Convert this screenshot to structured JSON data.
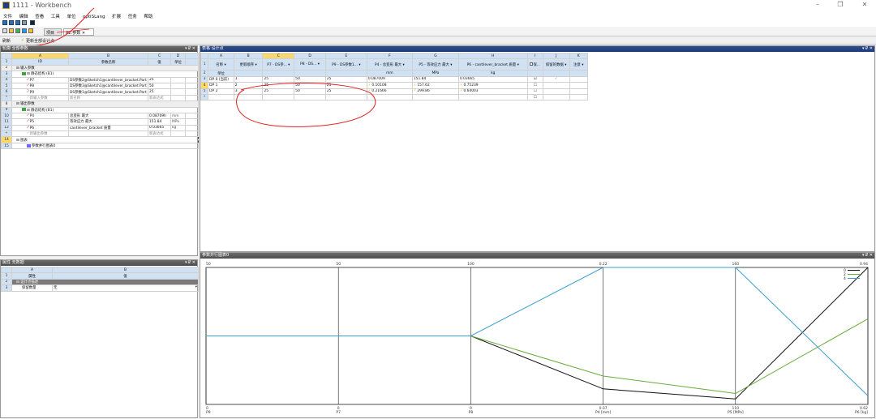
{
  "window": {
    "title": "1111 - Workbench",
    "controls": [
      "–",
      "❐",
      "✕"
    ]
  },
  "menu": [
    "文件",
    "编辑",
    "查看",
    "工具",
    "单位",
    "optiSLang",
    "扩展",
    "任务",
    "帮助"
  ],
  "tabs": {
    "project": "项目",
    "workspace": "A2:参数 ✕"
  },
  "toolbar3": {
    "refresh": "刷新",
    "update_all": "更新全部设计点"
  },
  "outline": {
    "header": "轮廓 全部参数",
    "controls": "▾ ₽ ✕",
    "col_letters": [
      "A",
      "B",
      "C",
      "D"
    ],
    "col_headers": [
      "ID",
      "参数名称",
      "值",
      "单位"
    ],
    "rows": [
      {
        "num": "1",
        "id": "ID",
        "name": "参数名称",
        "value": "值",
        "unit": "单位"
      },
      {
        "num": "2",
        "id": "⊟  输入参数",
        "name": "",
        "value": "",
        "unit": ""
      },
      {
        "num": "3",
        "id": "⊟  静态结构 (B1)",
        "name": "",
        "value": "",
        "unit": ""
      },
      {
        "num": "4",
        "id": "P7",
        "name": "DS参数2@Sketch1@cantilever_bracket.Part",
        "value": "25",
        "unit": ""
      },
      {
        "num": "5",
        "id": "P8",
        "name": "DS参数3@Sketch1@cantilever_bracket.Part",
        "value": "50",
        "unit": ""
      },
      {
        "num": "6",
        "id": "P9",
        "name": "DS参数1@Sketch1@cantilever_bracket.Part",
        "value": "25",
        "unit": ""
      },
      {
        "num": "*",
        "id": "新输入参数",
        "name": "新名称",
        "value": "新表达式",
        "unit": ""
      },
      {
        "num": "8",
        "id": "⊟  输出参数",
        "name": "",
        "value": "",
        "unit": ""
      },
      {
        "num": "9",
        "id": "⊟  静态结构 (B1)",
        "name": "",
        "value": "",
        "unit": ""
      },
      {
        "num": "10",
        "id": "P4",
        "name": "总变形 最大",
        "value": "0.08709h",
        "unit": "mm"
      },
      {
        "num": "11",
        "id": "P5",
        "name": "等效应力 最大",
        "value": "151.84",
        "unit": "MPa"
      },
      {
        "num": "12",
        "id": "P6",
        "name": "cantilever_bracket 质量",
        "value": "0.03665",
        "unit": "kg"
      },
      {
        "num": "*",
        "id": "新输出参数",
        "name": "",
        "value": "新表达式",
        "unit": ""
      },
      {
        "num": "14",
        "id": "⊟  图表",
        "name": "",
        "value": "",
        "unit": ""
      },
      {
        "num": "15",
        "id": "参数并行图表0",
        "name": "",
        "value": "",
        "unit": ""
      }
    ]
  },
  "properties": {
    "header": "属性 无数据",
    "controls": "▾ ₽ ✕",
    "col_letters": [
      "A",
      "B"
    ],
    "col_headers": [
      "属性",
      "值"
    ],
    "rows": [
      {
        "num": "1",
        "prop": "属性",
        "value": "值"
      },
      {
        "num": "2",
        "prop": "⊟  设计点描述",
        "value": ""
      },
      {
        "num": "3",
        "prop": "保留数量",
        "value": "无"
      }
    ]
  },
  "design_points": {
    "header": "表格 设计点",
    "controls": "▾ ₽ ✕",
    "col_letters": [
      "A",
      "B",
      "C",
      "D",
      "E",
      "F",
      "G",
      "H",
      "I",
      "J",
      "K"
    ],
    "col_headers": [
      "名称",
      "更新顺序",
      "P7 - DS参...",
      "P8 - DS...",
      "P9 - DS参数1...",
      "P4 - 总变形 最大",
      "P5 - 等效应力 最大",
      "P6 - cantilever_bracket 质量",
      "保...",
      "保留的数据",
      "注意"
    ],
    "units": [
      "单位",
      "",
      "",
      "",
      "",
      "mm",
      "MPa",
      "kg",
      "",
      "",
      ""
    ],
    "rows": [
      {
        "num": "3",
        "name": "DP 0 (当前)",
        "order": "1",
        "p7": "25",
        "p8": "50",
        "p9": "25",
        "p4": "0.087009",
        "p5": "151.84",
        "p6": "0.03665",
        "keep": "☑",
        "kept": "✓",
        "note": ""
      },
      {
        "num": "4",
        "name": "DP 1",
        "order": "2",
        "p7": "25",
        "p8": "50",
        "p9": "25",
        "p4": "0.10108",
        "p5": "157.62",
        "p6": "0.75239",
        "keep": "☐",
        "kept": "",
        "note": ""
      },
      {
        "num": "5",
        "name": "DP 2",
        "order": "3",
        "p7": "25",
        "p8": "50",
        "p9": "25",
        "p4": "0.21666",
        "p5": "299.86",
        "p6": "0.64003",
        "keep": "☐",
        "kept": "",
        "note": ""
      },
      {
        "num": "*",
        "name": "",
        "order": "",
        "p7": "",
        "p8": "",
        "p9": "",
        "p4": "",
        "p5": "",
        "p6": "",
        "keep": "☐",
        "kept": "",
        "note": ""
      }
    ]
  },
  "chart_pane": {
    "header": "参数并行图表0",
    "controls": "▾ ₽ ✕"
  },
  "chart_data": {
    "type": "line",
    "subtype": "parallel-coordinates",
    "axes": [
      "P9",
      "P7",
      "P8",
      "P4 [mm]",
      "P5 [MPa]",
      "P6 [kg]"
    ],
    "axis_min_labels": [
      "0",
      "0",
      "0",
      "0.07",
      "110",
      "0.62"
    ],
    "axis_max_labels": [
      "50",
      "50",
      "100",
      "0.22",
      "160",
      "0.94"
    ],
    "series": [
      {
        "name": "0",
        "color": "#111111",
        "values": [
          25,
          25,
          50,
          0.087,
          112,
          0.94
        ]
      },
      {
        "name": "2",
        "color": "#6aaa3a",
        "values": [
          25,
          25,
          50,
          0.10108,
          114,
          0.82
        ]
      },
      {
        "name": "4",
        "color": "#3b9fd1",
        "values": [
          25,
          25,
          50,
          0.22,
          160,
          0.64
        ]
      }
    ]
  }
}
